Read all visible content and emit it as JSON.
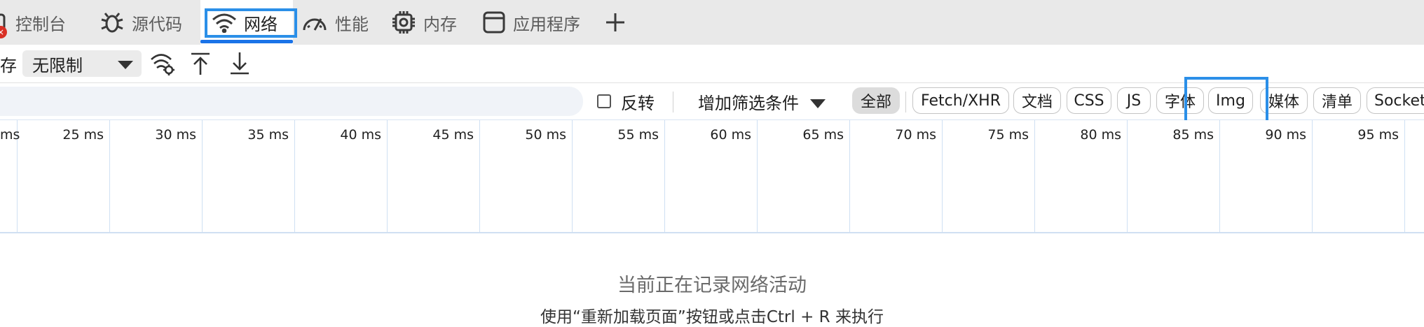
{
  "tabs": [
    {
      "label": "控制台",
      "icon": "console-icon",
      "badge": "×"
    },
    {
      "label": "源代码",
      "icon": "bug-icon"
    },
    {
      "label": "网络",
      "icon": "wifi-icon",
      "active": true
    },
    {
      "label": "性能",
      "icon": "gauge-icon"
    },
    {
      "label": "内存",
      "icon": "chip-icon"
    },
    {
      "label": "应用程序",
      "icon": "window-icon"
    },
    {
      "label": "+",
      "icon": "plus-icon"
    }
  ],
  "toolbar": {
    "cache_label": "存",
    "throttle_value": "无限制",
    "icons": [
      "network-conditions-icon",
      "upload-icon",
      "download-icon"
    ]
  },
  "filter": {
    "placeholder": "",
    "invert_label": "反转",
    "more_filters_label": "增加筛选条件",
    "chips": [
      "全部",
      "Fetch/XHR",
      "文档",
      "CSS",
      "JS",
      "字体",
      "Img",
      "媒体",
      "清单",
      "Socket"
    ],
    "selected_chip": "全部"
  },
  "timeline": {
    "ticks": [
      "ms",
      "25 ms",
      "30 ms",
      "35 ms",
      "40 ms",
      "45 ms",
      "50 ms",
      "55 ms",
      "60 ms",
      "65 ms",
      "70 ms",
      "75 ms",
      "80 ms",
      "85 ms",
      "90 ms",
      "95 ms"
    ]
  },
  "empty_state": {
    "title": "当前正在记录网络活动",
    "hint": "使用“重新加载页面”按钮或点击Ctrl + R 来执行"
  },
  "colors": {
    "accent": "#1a73e8",
    "highlight_box": "#2b8fe8",
    "badge_red": "#d93025",
    "timeline_grid": "#cfe0f3"
  }
}
